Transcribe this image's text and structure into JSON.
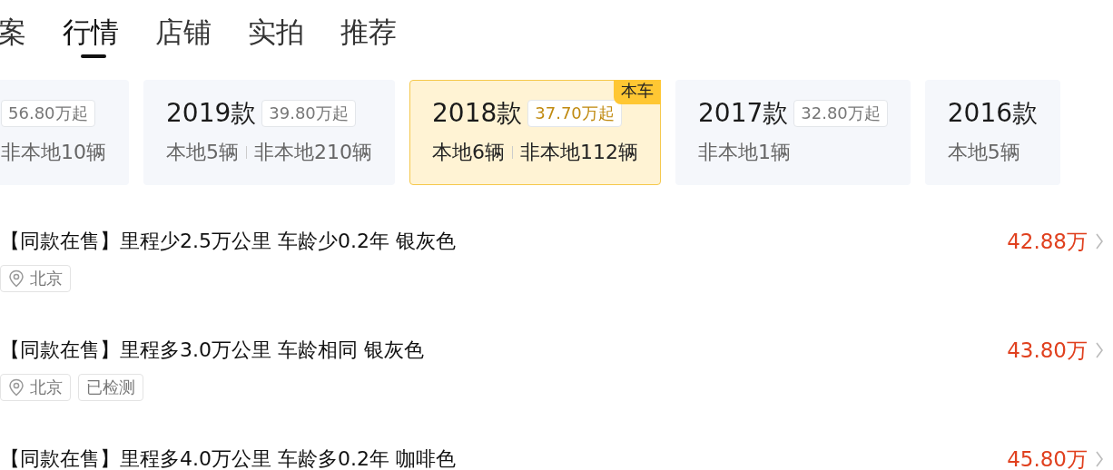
{
  "tabs": [
    {
      "label": "案",
      "selected": false
    },
    {
      "label": "行情",
      "selected": true
    },
    {
      "label": "店铺",
      "selected": false
    },
    {
      "label": "实拍",
      "selected": false
    },
    {
      "label": "推荐",
      "selected": false
    }
  ],
  "model_years": [
    {
      "price": "56.80万起",
      "counts": [
        "非本地10辆"
      ],
      "selected": false
    },
    {
      "year": "2019款",
      "price": "39.80万起",
      "counts": [
        "本地5辆",
        "非本地210辆"
      ],
      "selected": false
    },
    {
      "year": "2018款",
      "price": "37.70万起",
      "counts": [
        "本地6辆",
        "非本地112辆"
      ],
      "selected": true,
      "badge": "本车"
    },
    {
      "year": "2017款",
      "price": "32.80万起",
      "counts": [
        "非本地1辆"
      ],
      "selected": false
    },
    {
      "year": "2016款",
      "counts": [
        "本地5辆"
      ],
      "selected": false
    }
  ],
  "listings": [
    {
      "title": "【同款在售】里程少2.5万公里 车龄少0.2年 银灰色",
      "price": "42.88万",
      "tags": [
        {
          "kind": "location",
          "label": "北京"
        }
      ]
    },
    {
      "title": "【同款在售】里程多3.0万公里 车龄相同 银灰色",
      "price": "43.80万",
      "tags": [
        {
          "kind": "location",
          "label": "北京"
        },
        {
          "kind": "plain",
          "label": "已检测"
        }
      ]
    },
    {
      "title": "【同款在售】里程多4.0万公里 车龄多0.2年 咖啡色",
      "price": "45.80万"
    }
  ]
}
